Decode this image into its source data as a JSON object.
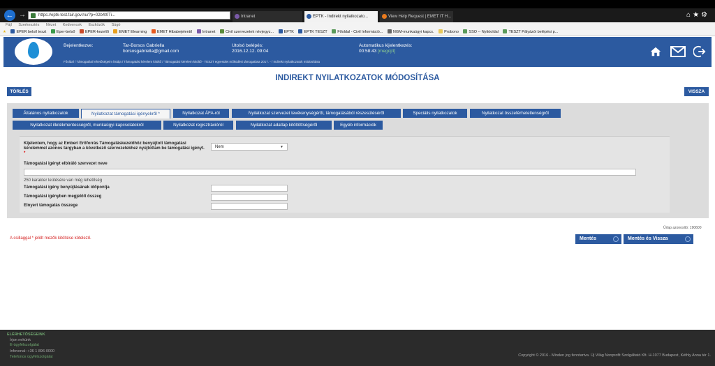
{
  "browser": {
    "url": "https://eptk-test.fair.gov.hu/?p=02b4t0Ti...",
    "tabs": [
      {
        "label": "Intranet"
      },
      {
        "label": "EPTK - Indirekt nyilatkozato..."
      },
      {
        "label": "View Help Request | EMET IT H..."
      }
    ],
    "menu": [
      "Fájl",
      "Szerkesztés",
      "Nézet",
      "Kedvencek",
      "Eszközök",
      "Súgó"
    ],
    "favorites": [
      "EPER belső teszt",
      "Eper-belső",
      "EPER-kezelői",
      "EMET Elearning",
      "EMET Hibabejelentő",
      "Intranet",
      "Civil szervezetek névjegyz...",
      "EPTK",
      "EPTK TESZT",
      "Főoldal - Civil Információ...",
      "NGM-munkaügyi kapcs.",
      "Probono",
      "SSO -- Nyitóoldal",
      "TESZT Pályázói belépési p..."
    ]
  },
  "header": {
    "logo_text": "Nemzeti Együttműködési Alap 2020",
    "login_label": "Bejelentkezve:",
    "user_name": "Tar-Borsos Gabriella",
    "user_email": "borsosgabriella@gmail.com",
    "last_login_label": "Utolsó belépés:",
    "last_login_value": "2016.12.12. 09:04",
    "auto_logout_label": "Automatikus kijelentkezés:",
    "auto_logout_value": "00:58:43",
    "auto_logout_extra": "[megújít]",
    "breadcrumb": "Főoldal  /  Támogatási lehetőségeim listája  /  Támogatási kérelem kitöltő  /  Támogatási kérelem kitöltő - TESZT egyesület működési támogatása 2017. -  /  Indirekt nyilatkozatok módosítása"
  },
  "page": {
    "title": "INDIREKT NYILATKOZATOK MÓDOSÍTÁSA",
    "delete_label": "TÖRLÉS",
    "back_label": "VISSZA"
  },
  "tabs_row1": [
    "Általános nyilatkozatok",
    "Nyilatkozat támogatási igényekről *",
    "Nyilatkozat ÁFA-ról",
    "Nyilatkozat szervezet tevékenységéről, támogatásából részesüléséről",
    "Speciális nyilatkozatok",
    "Nyilatkozat összeférhetetlenségről"
  ],
  "tabs_row2": [
    "Nyilatkozat illetékmentességről, munkaügyi kapcsolatokról",
    "Nyilatkozat regisztrációról",
    "Nyilatkozat adatlap kitöltöttségéről",
    "Egyéb információk"
  ],
  "form": {
    "declaration_label": "Kijelentem, hogy az Emberi Erőforrás Támogatáskezelőhöz benyújtott támogatási kérelemmel azonos tárgyban a következő szervezetekhez nyújtottam be támogatási igényt.",
    "declaration_value": "Nem",
    "org_label": "Támogatási igényt elbíráló szervezet neve",
    "chars_hint": "250 karakter leütésére van még lehetőség",
    "date_label": "Támogatási igény benyújtásának időpontja",
    "amount_requested_label": "Támogatási igényben megjelölt összeg",
    "amount_won_label": "Elnyert támogatás összege"
  },
  "form_id": "Űrlap azonosító: 190600",
  "required_note": "A csillaggal * jelölt mezők kitöltése kötelező.",
  "save_label": "Mentés",
  "save_back_label": "Mentés és Vissza",
  "footer": {
    "heading": "ELÉRHETŐSÉGEINK",
    "links": [
      "Írjon nekünk",
      "E-ügyfélszolgálat",
      "Infovonal: +36 1 896-0000",
      "Telefonos ügyfélszolgálat"
    ],
    "copyright": "Copyright © 2016 - Minden jog fenntartva. Új Világ Nonprofit Szolgáltató Kft. H-1077 Budapest, Kéthly Anna tér 1."
  },
  "colors": {
    "brand_blue": "#2c5aa0",
    "required_red": "#d42020",
    "timer_green": "#8fd08f"
  }
}
